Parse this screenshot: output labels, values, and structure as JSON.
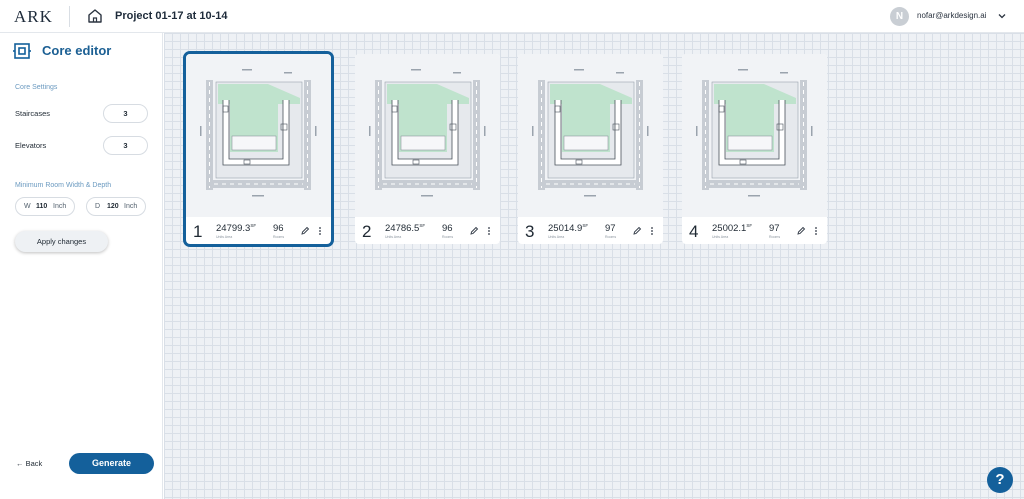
{
  "header": {
    "logo": "ARK",
    "project_title": "Project 01-17 at 10-14",
    "user": {
      "avatar_letter": "N",
      "email": "nofar@arkdesign.ai"
    }
  },
  "sidebar": {
    "title": "Core editor",
    "core_settings_label": "Core Settings",
    "staircases": {
      "label": "Staircases",
      "value": "3"
    },
    "elevators": {
      "label": "Elevators",
      "value": "3"
    },
    "min_room_label": "Minimum Room Width & Depth",
    "width": {
      "prefix": "W",
      "value": "110",
      "unit": "Inch"
    },
    "depth": {
      "prefix": "D",
      "value": "120",
      "unit": "Inch"
    },
    "apply_label": "Apply changes",
    "back_label": "← Back",
    "generate_label": "Generate"
  },
  "cards": [
    {
      "index": "1",
      "area": "24799.3",
      "area_unit": "SF",
      "area_caption": "Units Area",
      "rooms": "96",
      "rooms_caption": "Rooms",
      "selected": true
    },
    {
      "index": "2",
      "area": "24786.5",
      "area_unit": "SF",
      "area_caption": "Units Area",
      "rooms": "96",
      "rooms_caption": "Rooms",
      "selected": false
    },
    {
      "index": "3",
      "area": "25014.9",
      "area_unit": "SF",
      "area_caption": "Units Area",
      "rooms": "97",
      "rooms_caption": "Rooms",
      "selected": false
    },
    {
      "index": "4",
      "area": "25002.1",
      "area_unit": "SF",
      "area_caption": "Units Area",
      "rooms": "97",
      "rooms_caption": "Rooms",
      "selected": false
    }
  ],
  "help_label": "?",
  "colors": {
    "accent": "#14609b",
    "plan_green": "#bfe3cd",
    "grid": "#d9dfe7"
  }
}
